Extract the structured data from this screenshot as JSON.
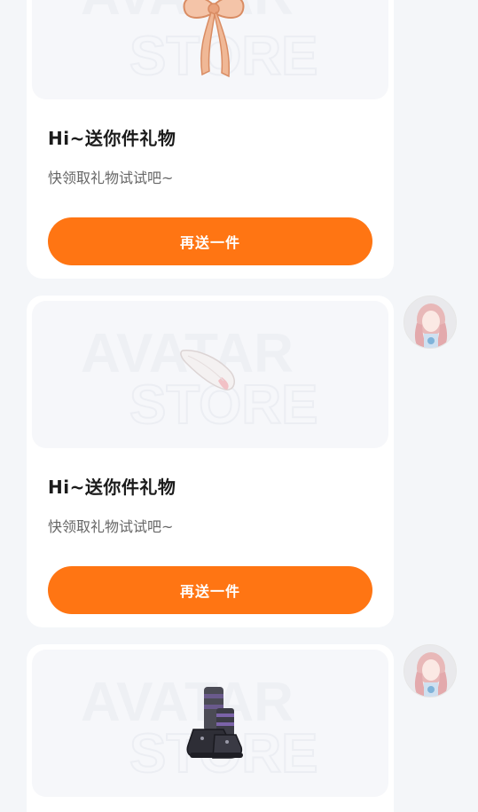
{
  "watermark": {
    "line1": "AVATAR",
    "line2": "STORE"
  },
  "messages": [
    {
      "gift_icon": "bow-ribbon-icon",
      "title": "Hi~送你件礼物",
      "subtitle": "快领取礼物试试吧~",
      "button_label": "再送一件"
    },
    {
      "gift_icon": "feather-tail-icon",
      "title": "Hi~送你件礼物",
      "subtitle": "快领取礼物试试吧~",
      "button_label": "再送一件"
    },
    {
      "gift_icon": "striped-boots-icon"
    }
  ],
  "colors": {
    "accent": "#ff7513",
    "page_bg": "#f4f6f9",
    "card_bg": "#ffffff"
  }
}
